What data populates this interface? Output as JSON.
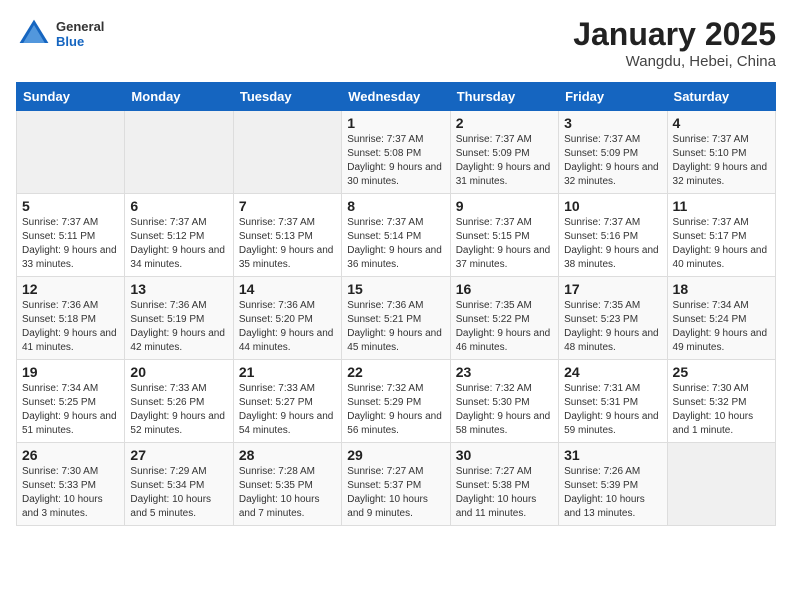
{
  "header": {
    "logo_general": "General",
    "logo_blue": "Blue",
    "month_title": "January 2025",
    "location": "Wangdu, Hebei, China"
  },
  "weekdays": [
    "Sunday",
    "Monday",
    "Tuesday",
    "Wednesday",
    "Thursday",
    "Friday",
    "Saturday"
  ],
  "weeks": [
    [
      {
        "day": "",
        "info": ""
      },
      {
        "day": "",
        "info": ""
      },
      {
        "day": "",
        "info": ""
      },
      {
        "day": "1",
        "info": "Sunrise: 7:37 AM\nSunset: 5:08 PM\nDaylight: 9 hours\nand 30 minutes."
      },
      {
        "day": "2",
        "info": "Sunrise: 7:37 AM\nSunset: 5:09 PM\nDaylight: 9 hours\nand 31 minutes."
      },
      {
        "day": "3",
        "info": "Sunrise: 7:37 AM\nSunset: 5:09 PM\nDaylight: 9 hours\nand 32 minutes."
      },
      {
        "day": "4",
        "info": "Sunrise: 7:37 AM\nSunset: 5:10 PM\nDaylight: 9 hours\nand 32 minutes."
      }
    ],
    [
      {
        "day": "5",
        "info": "Sunrise: 7:37 AM\nSunset: 5:11 PM\nDaylight: 9 hours\nand 33 minutes."
      },
      {
        "day": "6",
        "info": "Sunrise: 7:37 AM\nSunset: 5:12 PM\nDaylight: 9 hours\nand 34 minutes."
      },
      {
        "day": "7",
        "info": "Sunrise: 7:37 AM\nSunset: 5:13 PM\nDaylight: 9 hours\nand 35 minutes."
      },
      {
        "day": "8",
        "info": "Sunrise: 7:37 AM\nSunset: 5:14 PM\nDaylight: 9 hours\nand 36 minutes."
      },
      {
        "day": "9",
        "info": "Sunrise: 7:37 AM\nSunset: 5:15 PM\nDaylight: 9 hours\nand 37 minutes."
      },
      {
        "day": "10",
        "info": "Sunrise: 7:37 AM\nSunset: 5:16 PM\nDaylight: 9 hours\nand 38 minutes."
      },
      {
        "day": "11",
        "info": "Sunrise: 7:37 AM\nSunset: 5:17 PM\nDaylight: 9 hours\nand 40 minutes."
      }
    ],
    [
      {
        "day": "12",
        "info": "Sunrise: 7:36 AM\nSunset: 5:18 PM\nDaylight: 9 hours\nand 41 minutes."
      },
      {
        "day": "13",
        "info": "Sunrise: 7:36 AM\nSunset: 5:19 PM\nDaylight: 9 hours\nand 42 minutes."
      },
      {
        "day": "14",
        "info": "Sunrise: 7:36 AM\nSunset: 5:20 PM\nDaylight: 9 hours\nand 44 minutes."
      },
      {
        "day": "15",
        "info": "Sunrise: 7:36 AM\nSunset: 5:21 PM\nDaylight: 9 hours\nand 45 minutes."
      },
      {
        "day": "16",
        "info": "Sunrise: 7:35 AM\nSunset: 5:22 PM\nDaylight: 9 hours\nand 46 minutes."
      },
      {
        "day": "17",
        "info": "Sunrise: 7:35 AM\nSunset: 5:23 PM\nDaylight: 9 hours\nand 48 minutes."
      },
      {
        "day": "18",
        "info": "Sunrise: 7:34 AM\nSunset: 5:24 PM\nDaylight: 9 hours\nand 49 minutes."
      }
    ],
    [
      {
        "day": "19",
        "info": "Sunrise: 7:34 AM\nSunset: 5:25 PM\nDaylight: 9 hours\nand 51 minutes."
      },
      {
        "day": "20",
        "info": "Sunrise: 7:33 AM\nSunset: 5:26 PM\nDaylight: 9 hours\nand 52 minutes."
      },
      {
        "day": "21",
        "info": "Sunrise: 7:33 AM\nSunset: 5:27 PM\nDaylight: 9 hours\nand 54 minutes."
      },
      {
        "day": "22",
        "info": "Sunrise: 7:32 AM\nSunset: 5:29 PM\nDaylight: 9 hours\nand 56 minutes."
      },
      {
        "day": "23",
        "info": "Sunrise: 7:32 AM\nSunset: 5:30 PM\nDaylight: 9 hours\nand 58 minutes."
      },
      {
        "day": "24",
        "info": "Sunrise: 7:31 AM\nSunset: 5:31 PM\nDaylight: 9 hours\nand 59 minutes."
      },
      {
        "day": "25",
        "info": "Sunrise: 7:30 AM\nSunset: 5:32 PM\nDaylight: 10 hours\nand 1 minute."
      }
    ],
    [
      {
        "day": "26",
        "info": "Sunrise: 7:30 AM\nSunset: 5:33 PM\nDaylight: 10 hours\nand 3 minutes."
      },
      {
        "day": "27",
        "info": "Sunrise: 7:29 AM\nSunset: 5:34 PM\nDaylight: 10 hours\nand 5 minutes."
      },
      {
        "day": "28",
        "info": "Sunrise: 7:28 AM\nSunset: 5:35 PM\nDaylight: 10 hours\nand 7 minutes."
      },
      {
        "day": "29",
        "info": "Sunrise: 7:27 AM\nSunset: 5:37 PM\nDaylight: 10 hours\nand 9 minutes."
      },
      {
        "day": "30",
        "info": "Sunrise: 7:27 AM\nSunset: 5:38 PM\nDaylight: 10 hours\nand 11 minutes."
      },
      {
        "day": "31",
        "info": "Sunrise: 7:26 AM\nSunset: 5:39 PM\nDaylight: 10 hours\nand 13 minutes."
      },
      {
        "day": "",
        "info": ""
      }
    ]
  ]
}
